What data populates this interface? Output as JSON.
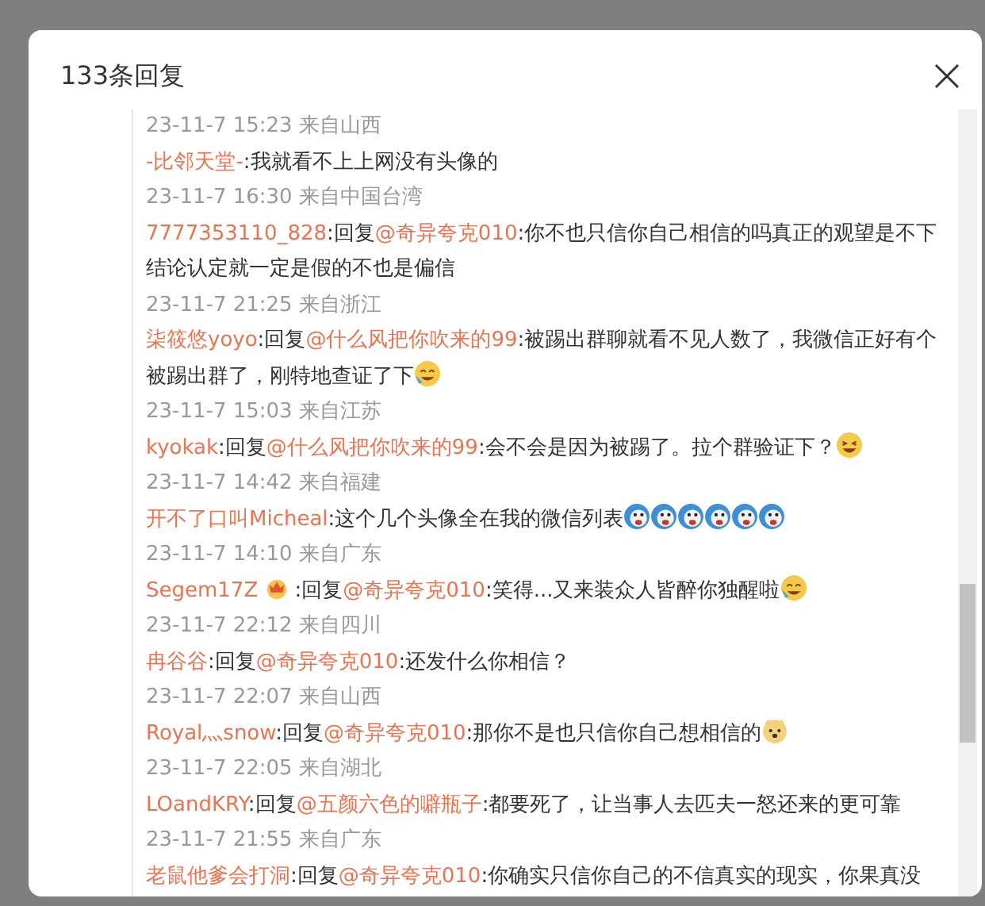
{
  "dialog": {
    "title": "133条回复"
  },
  "comments": [
    {
      "time": "23-11-7 15:23 来自山西",
      "author": "-比邻天堂-",
      "text": ":我就看不上上网没有头像的"
    },
    {
      "time": "23-11-7 16:30 来自中国台湾",
      "author": "7777353110_828",
      "reply": ":回复",
      "mention": "@奇异夸克010",
      "text": ":你不也只信你自己相信的吗真正的观望是不下结论认定就一定是假的不也是偏信"
    },
    {
      "time": "23-11-7 21:25 来自浙江",
      "author": "柒筱悠yoyo",
      "reply": ":回复",
      "mention": "@什么风把你吹来的99",
      "text": ":被踢出群聊就看不见人数了，我微信正好有个被踢出群了，刚特地查证了下",
      "emojis": [
        {
          "kind": "crying"
        }
      ]
    },
    {
      "time": "23-11-7 15:03 来自江苏",
      "author": "kyokak",
      "reply": ":回复",
      "mention": "@什么风把你吹来的99",
      "text": ":会不会是因为被踢了。拉个群验证下？",
      "emojis": [
        {
          "kind": "laughing"
        }
      ]
    },
    {
      "time": "23-11-7 14:42 来自福建",
      "author": "开不了口叫Micheal",
      "text": ":这个几个头像全在我的微信列表",
      "emojis": [
        {
          "kind": "round"
        },
        {
          "kind": "round"
        },
        {
          "kind": "round"
        },
        {
          "kind": "round"
        },
        {
          "kind": "round"
        },
        {
          "kind": "round"
        }
      ]
    },
    {
      "time": "23-11-7 14:10 来自广东",
      "author": "Segem17Z",
      "badge": true,
      "reply": " :回复",
      "mention": "@奇异夸克010",
      "text": ":笑得...又来装众人皆醉你独醒啦",
      "emojis": [
        {
          "kind": "crying"
        }
      ]
    },
    {
      "time": "23-11-7 22:12 来自四川",
      "author": "冉谷谷",
      "reply": ":回复",
      "mention": "@奇异夸克010",
      "text": ":还发什么你相信？"
    },
    {
      "time": "23-11-7 22:07 来自山西",
      "author": "Royal灬snow",
      "reply": ":回复",
      "mention": "@奇异夸克010",
      "text": ":那你不是也只信你自己想相信的",
      "emojis": [
        {
          "kind": "dog"
        }
      ]
    },
    {
      "time": "23-11-7 22:05 来自湖北",
      "author": "LOandKRY",
      "reply": ":回复",
      "mention": "@五颜六色的噼瓶子",
      "text": ":都要死了，让当事人去匹夫一怒还来的更可靠"
    },
    {
      "time": "23-11-7 21:55 来自广东",
      "author": "老鼠他爹会打洞",
      "reply": ":回复",
      "mention": "@奇异夸克010",
      "text": ":你确实只信你自己的不信真实的现实，你果真没"
    }
  ]
}
